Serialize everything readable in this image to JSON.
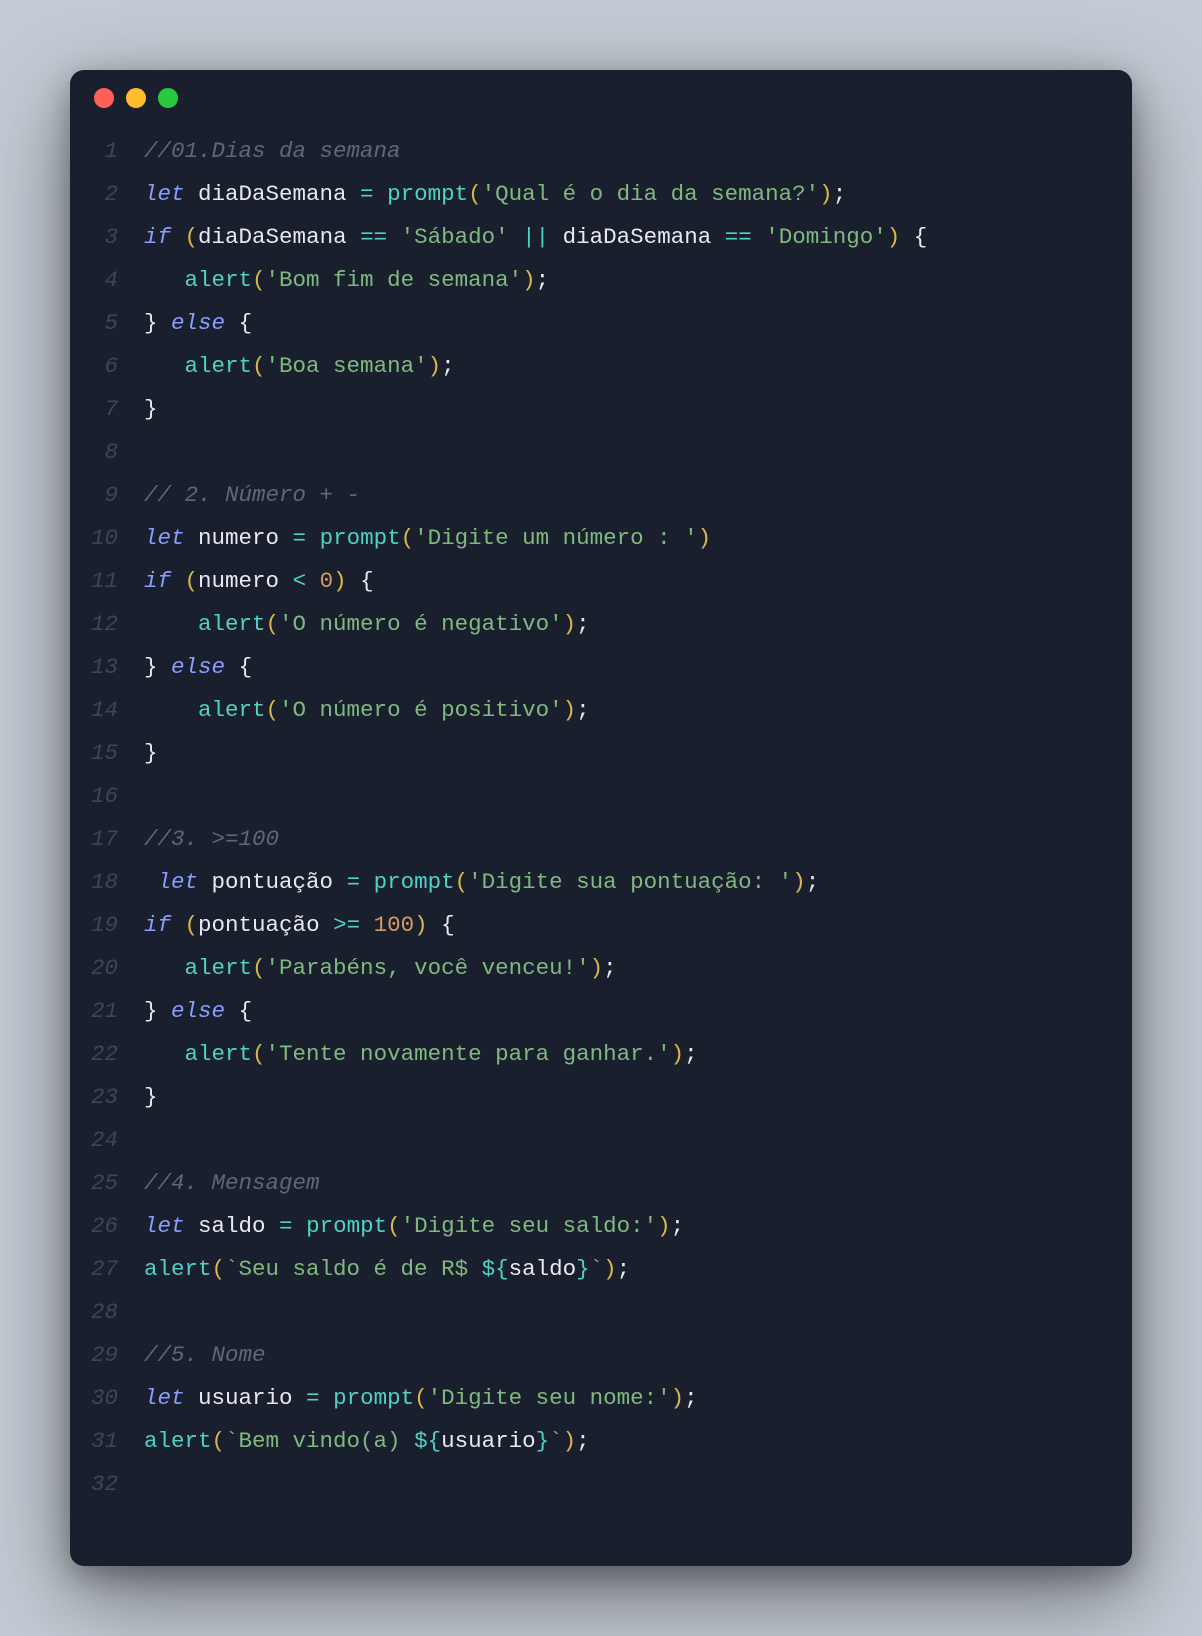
{
  "window": {
    "traffic_lights": [
      "close",
      "minimize",
      "zoom"
    ]
  },
  "code": {
    "lines": [
      {
        "n": 1,
        "tokens": [
          [
            "cm",
            "//01.Dias da semana"
          ]
        ]
      },
      {
        "n": 2,
        "tokens": [
          [
            "kw",
            "let"
          ],
          [
            "var",
            " diaDaSemana "
          ],
          [
            "op",
            "="
          ],
          [
            "var",
            " "
          ],
          [
            "fn",
            "prompt"
          ],
          [
            "paren",
            "("
          ],
          [
            "str",
            "'Qual é o dia da semana?'"
          ],
          [
            "paren",
            ")"
          ],
          [
            "var",
            ";"
          ]
        ]
      },
      {
        "n": 3,
        "tokens": [
          [
            "kw",
            "if"
          ],
          [
            "var",
            " "
          ],
          [
            "paren",
            "("
          ],
          [
            "var",
            "diaDaSemana "
          ],
          [
            "op",
            "=="
          ],
          [
            "var",
            " "
          ],
          [
            "str",
            "'Sábado'"
          ],
          [
            "var",
            " "
          ],
          [
            "op",
            "||"
          ],
          [
            "var",
            " diaDaSemana "
          ],
          [
            "op",
            "=="
          ],
          [
            "var",
            " "
          ],
          [
            "str",
            "'Domingo'"
          ],
          [
            "paren",
            ")"
          ],
          [
            "var",
            " "
          ],
          [
            "brace",
            "{"
          ]
        ]
      },
      {
        "n": 4,
        "tokens": [
          [
            "var",
            "   "
          ],
          [
            "fn",
            "alert"
          ],
          [
            "paren",
            "("
          ],
          [
            "str",
            "'Bom fim de semana'"
          ],
          [
            "paren",
            ")"
          ],
          [
            "var",
            ";"
          ]
        ]
      },
      {
        "n": 5,
        "tokens": [
          [
            "brace",
            "}"
          ],
          [
            "var",
            " "
          ],
          [
            "kw",
            "else"
          ],
          [
            "var",
            " "
          ],
          [
            "brace",
            "{"
          ]
        ]
      },
      {
        "n": 6,
        "tokens": [
          [
            "var",
            "   "
          ],
          [
            "fn",
            "alert"
          ],
          [
            "paren",
            "("
          ],
          [
            "str",
            "'Boa semana'"
          ],
          [
            "paren",
            ")"
          ],
          [
            "var",
            ";"
          ]
        ]
      },
      {
        "n": 7,
        "tokens": [
          [
            "brace",
            "}"
          ]
        ]
      },
      {
        "n": 8,
        "tokens": []
      },
      {
        "n": 9,
        "tokens": [
          [
            "cm",
            "// 2. Número + -"
          ]
        ]
      },
      {
        "n": 10,
        "tokens": [
          [
            "kw",
            "let"
          ],
          [
            "var",
            " numero "
          ],
          [
            "op",
            "="
          ],
          [
            "var",
            " "
          ],
          [
            "fn",
            "prompt"
          ],
          [
            "paren",
            "("
          ],
          [
            "str",
            "'Digite um número : '"
          ],
          [
            "paren",
            ")"
          ]
        ]
      },
      {
        "n": 11,
        "tokens": [
          [
            "kw",
            "if"
          ],
          [
            "var",
            " "
          ],
          [
            "paren",
            "("
          ],
          [
            "var",
            "numero "
          ],
          [
            "op",
            "<"
          ],
          [
            "var",
            " "
          ],
          [
            "num",
            "0"
          ],
          [
            "paren",
            ")"
          ],
          [
            "var",
            " "
          ],
          [
            "brace",
            "{"
          ]
        ]
      },
      {
        "n": 12,
        "tokens": [
          [
            "var",
            "    "
          ],
          [
            "fn",
            "alert"
          ],
          [
            "paren",
            "("
          ],
          [
            "str",
            "'O número é negativo'"
          ],
          [
            "paren",
            ")"
          ],
          [
            "var",
            ";"
          ]
        ]
      },
      {
        "n": 13,
        "tokens": [
          [
            "brace",
            "}"
          ],
          [
            "var",
            " "
          ],
          [
            "kw",
            "else"
          ],
          [
            "var",
            " "
          ],
          [
            "brace",
            "{"
          ]
        ]
      },
      {
        "n": 14,
        "tokens": [
          [
            "var",
            "    "
          ],
          [
            "fn",
            "alert"
          ],
          [
            "paren",
            "("
          ],
          [
            "str",
            "'O número é positivo'"
          ],
          [
            "paren",
            ")"
          ],
          [
            "var",
            ";"
          ]
        ]
      },
      {
        "n": 15,
        "tokens": [
          [
            "brace",
            "}"
          ]
        ]
      },
      {
        "n": 16,
        "tokens": []
      },
      {
        "n": 17,
        "tokens": [
          [
            "cm",
            "//3. >=100"
          ]
        ]
      },
      {
        "n": 18,
        "tokens": [
          [
            "var",
            " "
          ],
          [
            "kw",
            "let"
          ],
          [
            "var",
            " pontuação "
          ],
          [
            "op",
            "="
          ],
          [
            "var",
            " "
          ],
          [
            "fn",
            "prompt"
          ],
          [
            "paren",
            "("
          ],
          [
            "str",
            "'Digite sua pontuação: '"
          ],
          [
            "paren",
            ")"
          ],
          [
            "var",
            ";"
          ]
        ]
      },
      {
        "n": 19,
        "tokens": [
          [
            "kw",
            "if"
          ],
          [
            "var",
            " "
          ],
          [
            "paren",
            "("
          ],
          [
            "var",
            "pontuação "
          ],
          [
            "op",
            ">="
          ],
          [
            "var",
            " "
          ],
          [
            "num",
            "100"
          ],
          [
            "paren",
            ")"
          ],
          [
            "var",
            " "
          ],
          [
            "brace",
            "{"
          ]
        ]
      },
      {
        "n": 20,
        "tokens": [
          [
            "var",
            "   "
          ],
          [
            "fn",
            "alert"
          ],
          [
            "paren",
            "("
          ],
          [
            "str",
            "'Parabéns, você venceu!'"
          ],
          [
            "paren",
            ")"
          ],
          [
            "var",
            ";"
          ]
        ]
      },
      {
        "n": 21,
        "tokens": [
          [
            "brace",
            "}"
          ],
          [
            "var",
            " "
          ],
          [
            "kw",
            "else"
          ],
          [
            "var",
            " "
          ],
          [
            "brace",
            "{"
          ]
        ]
      },
      {
        "n": 22,
        "tokens": [
          [
            "var",
            "   "
          ],
          [
            "fn",
            "alert"
          ],
          [
            "paren",
            "("
          ],
          [
            "str",
            "'Tente novamente para ganhar.'"
          ],
          [
            "paren",
            ")"
          ],
          [
            "var",
            ";"
          ]
        ]
      },
      {
        "n": 23,
        "tokens": [
          [
            "brace",
            "}"
          ]
        ]
      },
      {
        "n": 24,
        "tokens": []
      },
      {
        "n": 25,
        "tokens": [
          [
            "cm",
            "//4. Mensagem"
          ]
        ]
      },
      {
        "n": 26,
        "tokens": [
          [
            "kw",
            "let"
          ],
          [
            "var",
            " saldo "
          ],
          [
            "op",
            "="
          ],
          [
            "var",
            " "
          ],
          [
            "fn",
            "prompt"
          ],
          [
            "paren",
            "("
          ],
          [
            "str",
            "'Digite seu saldo:'"
          ],
          [
            "paren",
            ")"
          ],
          [
            "var",
            ";"
          ]
        ]
      },
      {
        "n": 27,
        "tokens": [
          [
            "fn",
            "alert"
          ],
          [
            "paren",
            "("
          ],
          [
            "tmpl",
            "`Seu saldo é de R$ "
          ],
          [
            "tmpli",
            "${"
          ],
          [
            "tmpvar",
            "saldo"
          ],
          [
            "tmpli",
            "}"
          ],
          [
            "tmpl",
            "`"
          ],
          [
            "paren",
            ")"
          ],
          [
            "var",
            ";"
          ]
        ]
      },
      {
        "n": 28,
        "tokens": []
      },
      {
        "n": 29,
        "tokens": [
          [
            "cm",
            "//5. Nome"
          ]
        ]
      },
      {
        "n": 30,
        "tokens": [
          [
            "kw",
            "let"
          ],
          [
            "var",
            " usuario "
          ],
          [
            "op",
            "="
          ],
          [
            "var",
            " "
          ],
          [
            "fn",
            "prompt"
          ],
          [
            "paren",
            "("
          ],
          [
            "str",
            "'Digite seu nome:'"
          ],
          [
            "paren",
            ")"
          ],
          [
            "var",
            ";"
          ]
        ]
      },
      {
        "n": 31,
        "tokens": [
          [
            "fn",
            "alert"
          ],
          [
            "paren",
            "("
          ],
          [
            "tmpl",
            "`Bem vindo(a) "
          ],
          [
            "tmpli",
            "${"
          ],
          [
            "tmpvar",
            "usuario"
          ],
          [
            "tmpli",
            "}"
          ],
          [
            "tmpl",
            "`"
          ],
          [
            "paren",
            ")"
          ],
          [
            "var",
            ";"
          ]
        ]
      },
      {
        "n": 32,
        "tokens": []
      }
    ]
  }
}
